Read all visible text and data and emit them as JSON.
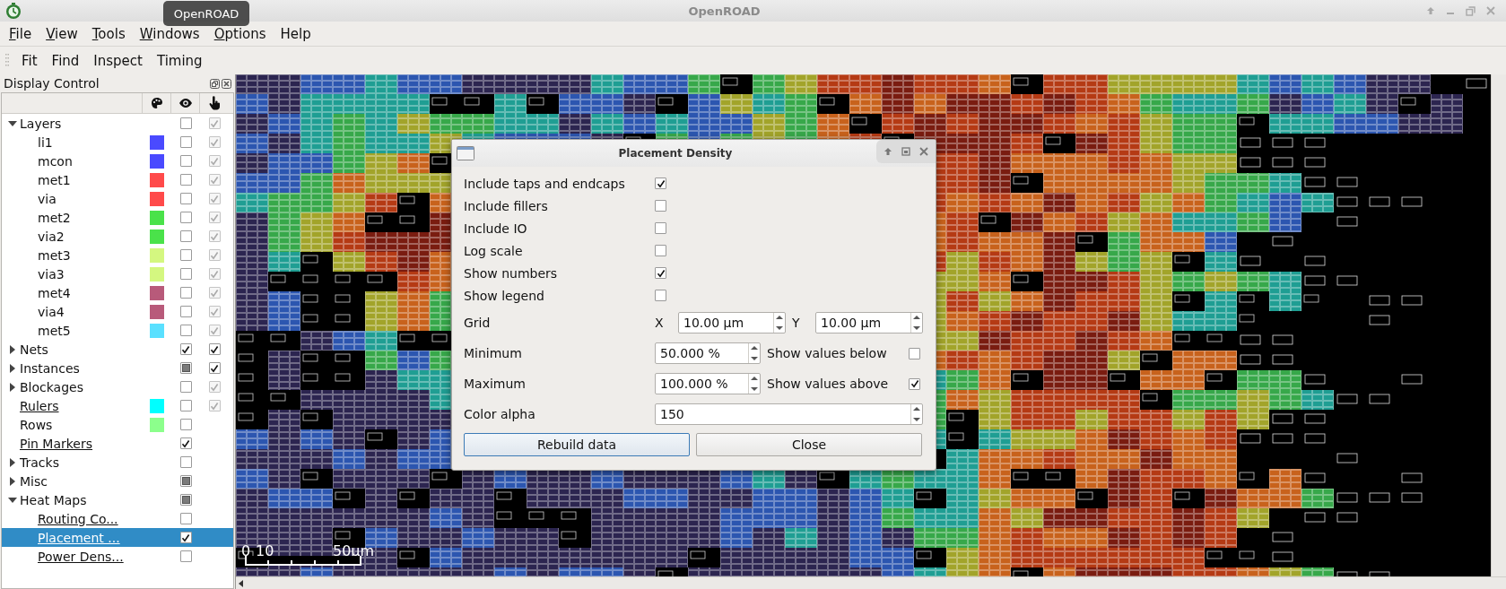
{
  "window": {
    "title": "OpenROAD"
  },
  "tooltip": {
    "text": "OpenROAD"
  },
  "menu": [
    {
      "key": "F",
      "rest": "ile"
    },
    {
      "key": "V",
      "rest": "iew"
    },
    {
      "key": "T",
      "rest": "ools"
    },
    {
      "key": "W",
      "rest": "indows"
    },
    {
      "key": "O",
      "rest": "ptions"
    },
    {
      "rest": "Help"
    }
  ],
  "toolbar": [
    "Fit",
    "Find",
    "Inspect",
    "Timing"
  ],
  "display_control": {
    "title": "Display Control",
    "items": [
      {
        "label": "Layers",
        "expanded": true,
        "underlined": false,
        "selected": false,
        "visible": false,
        "selectable": true,
        "selectable_disabled": true,
        "children": [
          {
            "label": "li1",
            "underlined": false,
            "selected": false,
            "color": "#4a4aff",
            "visible": false,
            "selectable": true,
            "selectable_disabled": true
          },
          {
            "label": "mcon",
            "underlined": false,
            "selected": false,
            "color": "#4a4aff",
            "visible": false,
            "selectable": true,
            "selectable_disabled": true
          },
          {
            "label": "met1",
            "underlined": false,
            "selected": false,
            "color": "#ff4a4a",
            "visible": false,
            "selectable": true,
            "selectable_disabled": true
          },
          {
            "label": "via",
            "underlined": false,
            "selected": false,
            "color": "#ff4a4a",
            "visible": false,
            "selectable": true,
            "selectable_disabled": true
          },
          {
            "label": "met2",
            "underlined": false,
            "selected": false,
            "color": "#4ae24a",
            "visible": false,
            "selectable": true,
            "selectable_disabled": true
          },
          {
            "label": "via2",
            "underlined": false,
            "selected": false,
            "color": "#4ae24a",
            "visible": false,
            "selectable": true,
            "selectable_disabled": true
          },
          {
            "label": "met3",
            "underlined": false,
            "selected": false,
            "color": "#d4f780",
            "visible": false,
            "selectable": true,
            "selectable_disabled": true
          },
          {
            "label": "via3",
            "underlined": false,
            "selected": false,
            "color": "#d4f780",
            "visible": false,
            "selectable": true,
            "selectable_disabled": true
          },
          {
            "label": "met4",
            "underlined": false,
            "selected": false,
            "color": "#b85a7a",
            "visible": false,
            "selectable": true,
            "selectable_disabled": true
          },
          {
            "label": "via4",
            "underlined": false,
            "selected": false,
            "color": "#b85a7a",
            "visible": false,
            "selectable": true,
            "selectable_disabled": true
          },
          {
            "label": "met5",
            "underlined": false,
            "selected": false,
            "color": "#5ae0ff",
            "visible": false,
            "selectable": true,
            "selectable_disabled": true
          }
        ]
      },
      {
        "label": "Nets",
        "expanded": false,
        "underlined": false,
        "selected": false,
        "visible": true,
        "selectable": true,
        "selectable_disabled": false
      },
      {
        "label": "Instances",
        "expanded": false,
        "underlined": false,
        "selected": false,
        "visible_partial": true,
        "selectable": true,
        "selectable_disabled": false
      },
      {
        "label": "Blockages",
        "expanded": false,
        "underlined": false,
        "selected": false,
        "visible": false,
        "selectable": true,
        "selectable_disabled": true
      },
      {
        "label": "Rulers",
        "underlined": true,
        "selected": false,
        "color": "#00ffff",
        "visible": false,
        "selectable": true,
        "selectable_disabled": true
      },
      {
        "label": "Rows",
        "underlined": false,
        "selected": false,
        "color": "#8cff8c",
        "visible": false
      },
      {
        "label": "Pin Markers",
        "underlined": true,
        "selected": false,
        "visible": true
      },
      {
        "label": "Tracks",
        "expanded": false,
        "underlined": false,
        "selected": false,
        "visible": false
      },
      {
        "label": "Misc",
        "expanded": false,
        "underlined": false,
        "selected": false,
        "visible_partial": true
      },
      {
        "label": "Heat Maps",
        "expanded": true,
        "underlined": false,
        "selected": false,
        "visible_partial": true,
        "children": [
          {
            "label": "Routing Co...",
            "underlined": true,
            "selected": false,
            "visible": false
          },
          {
            "label": "Placement ...",
            "underlined": true,
            "selected": true,
            "visible": true
          },
          {
            "label": "Power Dens...",
            "underlined": true,
            "selected": false,
            "visible": false
          }
        ]
      }
    ]
  },
  "scale_bar": {
    "labels": [
      "0",
      "10",
      "50µm"
    ]
  },
  "dialog": {
    "title": "Placement Density",
    "options": [
      {
        "label": "Include taps and endcaps",
        "checked": true
      },
      {
        "label": "Include fillers",
        "checked": false
      },
      {
        "label": "Include IO",
        "checked": false
      },
      {
        "label": "Log scale",
        "checked": false
      },
      {
        "label": "Show numbers",
        "checked": true
      },
      {
        "label": "Show legend",
        "checked": false
      }
    ],
    "grid": {
      "label": "Grid",
      "x_label": "X",
      "x_value": "10.00 µm",
      "y_label": "Y",
      "y_value": "10.00 µm"
    },
    "minimum": {
      "label": "Minimum",
      "value": "50.000 %",
      "toggle_label": "Show values below",
      "checked": false
    },
    "maximum": {
      "label": "Maximum",
      "value": "100.000 %",
      "toggle_label": "Show values above",
      "checked": true
    },
    "color_alpha": {
      "label": "Color alpha",
      "value": "150"
    },
    "buttons": [
      {
        "label": "Rebuild data",
        "default": true
      },
      {
        "label": "Close",
        "default": false
      }
    ]
  }
}
